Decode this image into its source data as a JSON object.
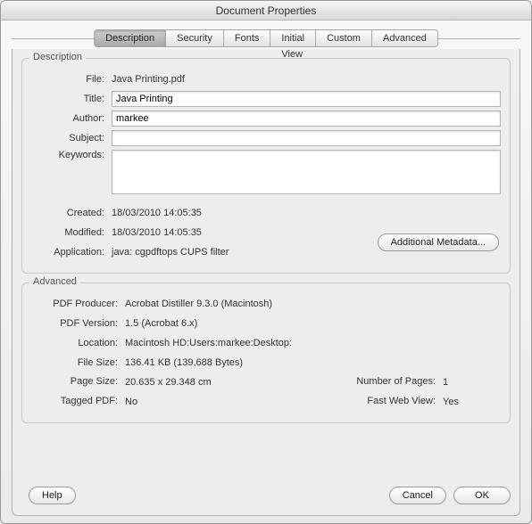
{
  "window": {
    "title": "Document Properties"
  },
  "tabs": {
    "description": "Description",
    "security": "Security",
    "fonts": "Fonts",
    "initial_view": "Initial View",
    "custom": "Custom",
    "advanced": "Advanced"
  },
  "description": {
    "group_title": "Description",
    "labels": {
      "file": "File:",
      "title": "Title:",
      "author": "Author:",
      "subject": "Subject:",
      "keywords": "Keywords:",
      "created": "Created:",
      "modified": "Modified:",
      "application": "Application:"
    },
    "file": "Java Printing.pdf",
    "title": "Java Printing",
    "author": "markee",
    "subject": "",
    "keywords": "",
    "created": "18/03/2010 14:05:35",
    "modified": "18/03/2010 14:05:35",
    "application": "java: cgpdftops CUPS filter",
    "additional_metadata_btn": "Additional Metadata..."
  },
  "advanced": {
    "group_title": "Advanced",
    "labels": {
      "pdf_producer": "PDF Producer:",
      "pdf_version": "PDF Version:",
      "location": "Location:",
      "file_size": "File Size:",
      "page_size": "Page Size:",
      "tagged_pdf": "Tagged PDF:",
      "number_of_pages": "Number of Pages:",
      "fast_web_view": "Fast Web View:"
    },
    "pdf_producer": "Acrobat Distiller 9.3.0 (Macintosh)",
    "pdf_version": "1.5 (Acrobat 6.x)",
    "location": "Macintosh HD:Users:markee:Desktop:",
    "file_size": "136.41 KB (139,688 Bytes)",
    "page_size": "20.635 x 29.348 cm",
    "tagged_pdf": "No",
    "number_of_pages": "1",
    "fast_web_view": "Yes"
  },
  "footer": {
    "help": "Help",
    "cancel": "Cancel",
    "ok": "OK"
  }
}
